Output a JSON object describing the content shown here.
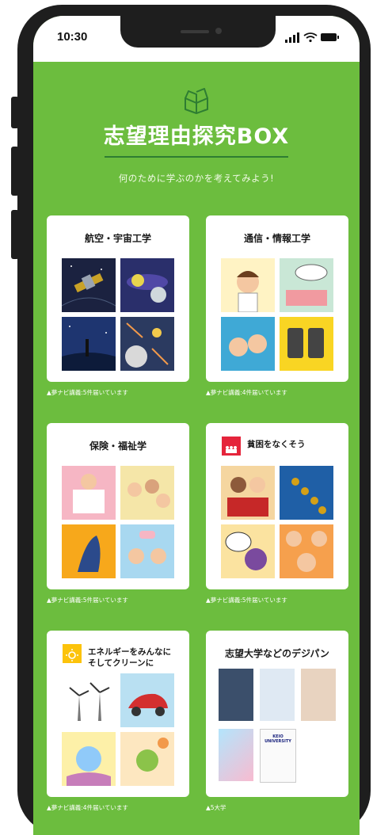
{
  "status": {
    "time": "10:30"
  },
  "hero": {
    "title": "志望理由探究BOX",
    "subtitle": "何のために学ぶのかを考えてみよう!"
  },
  "cards": [
    {
      "title": "航空・宇宙工学",
      "caption": "▲夢ナビ講義:5件届いています"
    },
    {
      "title": "通信・情報工学",
      "caption": "▲夢ナビ講義:4件届いています"
    },
    {
      "title": "保険・福祉学",
      "caption": "▲夢ナビ講義:5件届いています"
    },
    {
      "title": "貧困をなくそう",
      "caption": "▲夢ナビ講義:5件届いています",
      "sdg_number": "1"
    },
    {
      "title_line1": "エネルギーをみんなに",
      "title_line2": "そしてクリーンに",
      "caption": "▲夢ナビ講義:4件届いています",
      "sdg_number": "7"
    },
    {
      "title": "志望大学などのデジパン",
      "caption": "▲5大学",
      "books": [
        "",
        "",
        "",
        "",
        "KEIO UNIVERSITY"
      ]
    }
  ],
  "colors": {
    "background": "#6cbd3e",
    "card": "#ffffff",
    "accent_dark": "#2e7d32",
    "sdg1": "#e5243b",
    "sdg7": "#fcc30b"
  },
  "icons": [
    "signal-icon",
    "wifi-icon",
    "battery-icon",
    "box-icon"
  ]
}
